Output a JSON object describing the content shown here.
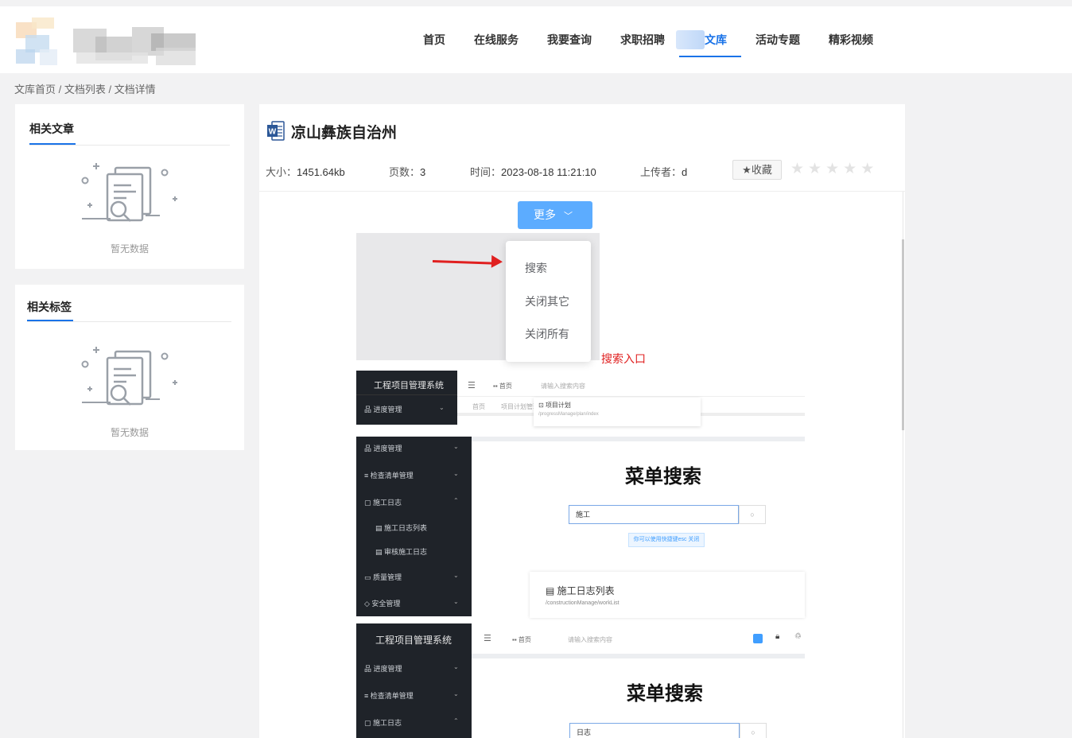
{
  "header": {
    "nav": [
      "首页",
      "在线服务",
      "我要查询",
      "求职招聘",
      "文库",
      "活动专题",
      "精彩视频"
    ],
    "active_index": 4,
    "accent_color": "#1a73e8"
  },
  "breadcrumb": "文库首页 / 文档列表 / 文档详情",
  "sidebar": {
    "related_articles": {
      "title": "相关文章",
      "empty_text": "暂无数据"
    },
    "related_tags": {
      "title": "相关标签",
      "empty_text": "暂无数据"
    }
  },
  "doc": {
    "title": "凉山彝族自治州",
    "size_label": "大小：",
    "size_value": "1451.64kb",
    "pages_label": "页数：",
    "pages_value": "3",
    "time_label": "时间：",
    "time_value": "2023-08-18 11:21:10",
    "uploader_label": "上传者：",
    "uploader_value": "d",
    "favorite_label": "收藏",
    "rating": 0,
    "rating_max": 5
  },
  "preview": {
    "more_button": "更多",
    "dropdown_items": [
      "搜索",
      "关闭其它",
      "关闭所有"
    ],
    "annotation": "搜索入口",
    "app1": {
      "system_name": "工程项目管理系统",
      "menu_item": "进度管理",
      "tab_home": "首页",
      "search_placeholder": "请输入搜索内容",
      "tab_home_2": "首页",
      "tab_2": "项目计划管理",
      "result_title": "项目计划",
      "result_path": "/progressManage/plan/index"
    },
    "app2": {
      "menu": [
        "进度管理",
        "检查清单管理",
        "施工日志",
        "施工日志列表",
        "审核施工日志",
        "质量管理",
        "安全管理"
      ],
      "heading": "菜单搜索",
      "input_value": "施工",
      "hint": "你可以使用快捷键esc 关闭",
      "result_title": "施工日志列表",
      "result_path": "/constructionManage/workList"
    },
    "app3": {
      "system_name": "工程项目管理系统",
      "menu": [
        "进度管理",
        "检查清单管理",
        "施工日志"
      ],
      "tab_home": "首页",
      "search_placeholder": "请输入搜索内容",
      "heading": "菜单搜索",
      "input_value": "日志"
    }
  }
}
